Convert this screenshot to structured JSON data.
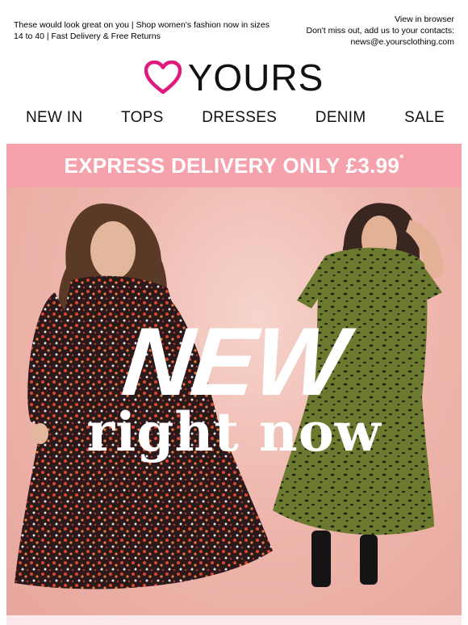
{
  "preheader": {
    "text": "These would look great on you | Shop women's fashion now in sizes 14 to 40 | Fast Delivery & Free Returns"
  },
  "topright": {
    "view_in_browser": "View in browser",
    "contacts_line": "Don't miss out, add us to your contacts:",
    "email": "news@e.yoursclothing.com"
  },
  "brand": {
    "name": "YOURS",
    "heart_color": "#e0197d"
  },
  "nav": {
    "items": [
      {
        "label": "NEW IN"
      },
      {
        "label": "TOPS"
      },
      {
        "label": "DRESSES"
      },
      {
        "label": "DENIM"
      },
      {
        "label": "SALE"
      }
    ]
  },
  "promo": {
    "text": "EXPRESS DELIVERY ONLY £3.99",
    "asterisk": "*",
    "bg_color": "#f6a2ad"
  },
  "hero": {
    "headline": "NEW",
    "subheadline": "right now",
    "bg_color": "#eeb7ad"
  }
}
